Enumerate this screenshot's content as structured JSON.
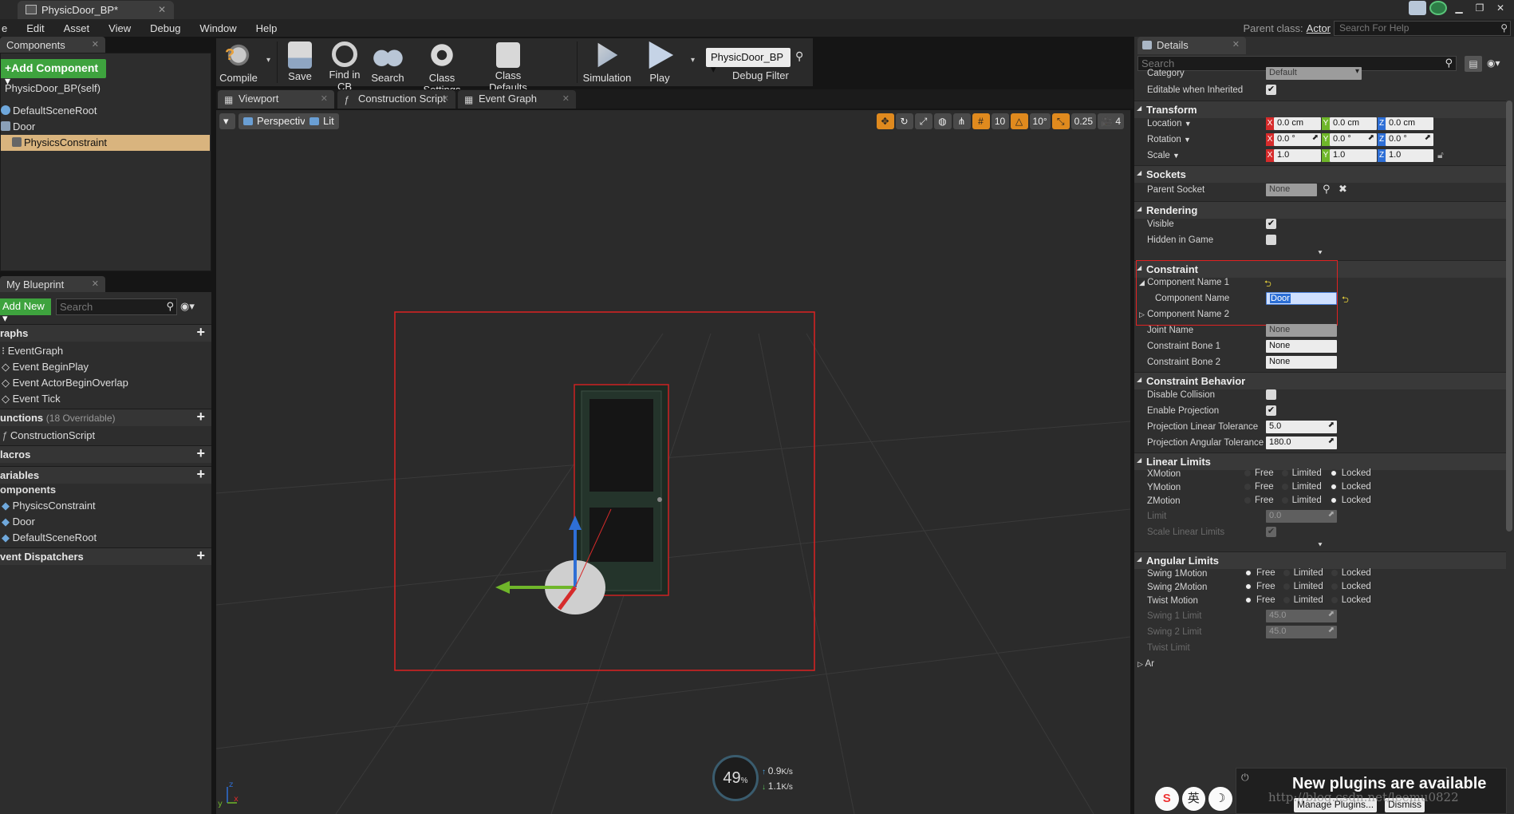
{
  "window": {
    "tab_title": "PhysicDoor_BP*",
    "parent_class_label": "Parent class:",
    "parent_class_value": "Actor",
    "help_search_placeholder": "Search For Help"
  },
  "menu": [
    "e",
    "Edit",
    "Asset",
    "View",
    "Debug",
    "Window",
    "Help"
  ],
  "components_panel": {
    "tab": "Components",
    "add_button": "+Add Component",
    "self_label": "PhysicDoor_BP(self)",
    "tree": [
      {
        "label": "DefaultSceneRoot",
        "selected": false
      },
      {
        "label": "Door",
        "selected": false
      },
      {
        "label": "PhysicsConstraint",
        "selected": true
      }
    ]
  },
  "myblueprint_panel": {
    "tab": "My Blueprint",
    "add_new": "Add New",
    "search_placeholder": "Search",
    "sections": {
      "graphs": "raphs",
      "functions": "unctions",
      "functions_sub": "(18 Overridable)",
      "macros": "lacros",
      "variables": "ariables",
      "components": "omponents",
      "dispatchers": "vent Dispatchers"
    },
    "graph_items": [
      "EventGraph",
      "Event BeginPlay",
      "Event ActorBeginOverlap",
      "Event Tick"
    ],
    "function_items": [
      "ConstructionScript"
    ],
    "component_items": [
      "PhysicsConstraint",
      "Door",
      "DefaultSceneRoot"
    ]
  },
  "toolbar": {
    "compile": "Compile",
    "save": "Save",
    "find_in_cb": "Find in CB",
    "search": "Search",
    "class_settings": "Class Settings",
    "class_defaults": "Class Defaults",
    "simulation": "Simulation",
    "play": "Play",
    "debug_object": "PhysicDoor_BP",
    "debug_filter": "Debug Filter"
  },
  "editor_tabs": [
    "Viewport",
    "Construction Script",
    "Event Graph"
  ],
  "viewport": {
    "view_mode": "Perspective",
    "lighting": "Lit",
    "grid_snap": "10",
    "rot_snap": "10°",
    "scale_snap": "0.25",
    "cam_speed": "4",
    "stats_percent": "49",
    "stats_pct_sign": "%",
    "stats_up": "0.9",
    "stats_up_unit": "K/s",
    "stats_down": "1.1",
    "stats_down_unit": "K/s"
  },
  "details": {
    "tab": "Details",
    "search_placeholder": "Search",
    "category_label": "Category",
    "category_value": "Default",
    "editable_label": "Editable when Inherited",
    "transform": "Transform",
    "location_label": "Location",
    "location": [
      "0.0 cm",
      "0.0 cm",
      "0.0 cm"
    ],
    "rotation_label": "Rotation",
    "rotation": [
      "0.0 °",
      "0.0 °",
      "0.0 °"
    ],
    "scale_label": "Scale",
    "scale": [
      "1.0",
      "1.0",
      "1.0"
    ],
    "axes": [
      "X",
      "Y",
      "Z"
    ],
    "sockets": "Sockets",
    "parent_socket_label": "Parent Socket",
    "parent_socket_value": "None",
    "rendering": "Rendering",
    "visible_label": "Visible",
    "hidden_label": "Hidden in Game",
    "constraint": "Constraint",
    "comp_name1_label": "Component Name 1",
    "comp_name_label": "Component Name",
    "comp_name_value": "Door",
    "comp_name2_label": "Component Name 2",
    "joint_name_label": "Joint Name",
    "joint_name_value": "None",
    "bone1_label": "Constraint Bone 1",
    "bone1_value": "None",
    "bone2_label": "Constraint Bone 2",
    "bone2_value": "None",
    "constraint_behavior": "Constraint Behavior",
    "disable_collision_label": "Disable Collision",
    "enable_projection_label": "Enable Projection",
    "proj_linear_label": "Projection Linear Tolerance",
    "proj_linear_value": "5.0",
    "proj_angular_label": "Projection Angular Tolerance",
    "proj_angular_value": "180.0",
    "linear_limits": "Linear Limits",
    "xmotion": "XMotion",
    "ymotion": "YMotion",
    "zmotion": "ZMotion",
    "limit_label": "Limit",
    "limit_value": "0.0",
    "scale_linear_label": "Scale Linear Limits",
    "angular_limits": "Angular Limits",
    "swing1motion": "Swing 1Motion",
    "swing2motion": "Swing 2Motion",
    "twistmotion": "Twist Motion",
    "swing1limit_label": "Swing 1 Limit",
    "swing1limit_value": "45.0",
    "swing2limit_label": "Swing 2 Limit",
    "swing2limit_value": "45.0",
    "twistlimit_label": "Twist Limit",
    "ar_label": "Ar",
    "opt_free": "Free",
    "opt_limited": "Limited",
    "opt_locked": "Locked"
  },
  "notification": {
    "title": "New plugins are available",
    "manage": "Manage Plugins...",
    "dismiss": "Dismiss"
  },
  "ime": [
    "S",
    "英",
    "☽",
    "👕"
  ],
  "watermark": "http://blog.csdn.net/leemu0822",
  "colors": {
    "accent_green": "#3ea33e",
    "selection": "#d9b47e",
    "highlight_red": "#e02222"
  }
}
